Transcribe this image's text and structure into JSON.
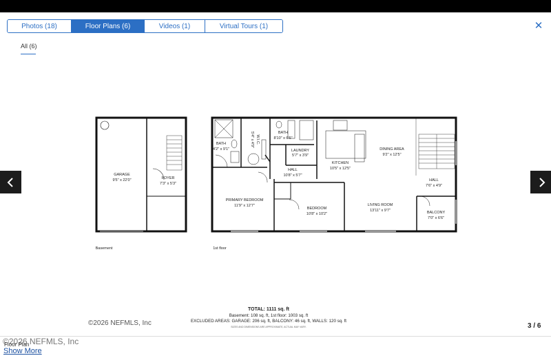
{
  "tabs": [
    {
      "label": "Photos (18)"
    },
    {
      "label": "Floor Plans (6)"
    },
    {
      "label": "Videos (1)"
    },
    {
      "label": "Virtual Tours (1)"
    }
  ],
  "active_tab": "Floor Plans (6)",
  "close_icon": "close-icon",
  "filter": {
    "label": "All (6)"
  },
  "nav": {
    "prev_icon": "chevron-left-icon",
    "next_icon": "chevron-right-icon"
  },
  "floorplan": {
    "floors": [
      {
        "label": "Basement"
      },
      {
        "label": "1st floor"
      }
    ],
    "rooms": [
      {
        "name": "GARAGE",
        "size": "9'5\" x 22'0\""
      },
      {
        "name": "FOYER",
        "size": "7'3\" x 5'3\""
      },
      {
        "name": "BATH",
        "size": "4'2\" x 9'1\""
      },
      {
        "name": "W.I.C.",
        "size": "5'4\" x 4'9\""
      },
      {
        "name": "BATH",
        "size": "8'10\" x 6'6\""
      },
      {
        "name": "LAUNDRY",
        "size": "5'7\" x 3'9\""
      },
      {
        "name": "HALL",
        "size": "10'8\" x 5'7\""
      },
      {
        "name": "KITCHEN",
        "size": "10'5\" x 12'5\""
      },
      {
        "name": "DINING AREA",
        "size": "9'2\" x 12'5\""
      },
      {
        "name": "HALL",
        "size": "7'6\" x 4'9\""
      },
      {
        "name": "PRIMARY BEDROOM",
        "size": "11'9\" x 12'7\""
      },
      {
        "name": "BEDROOM",
        "size": "10'8\" x 10'2\""
      },
      {
        "name": "LIVING ROOM",
        "size": "13'11\" x 9'7\""
      },
      {
        "name": "BALCONY",
        "size": "7'0\" x 6'6\""
      }
    ],
    "total": "TOTAL: 1111 sq. ft",
    "breakdown": "Basement: 108 sq. ft, 1st floor: 1003 sq. ft",
    "excluded": "EXCLUDED AREAS: GARAGE: 206 sq. ft, BALCONY: 46 sq. ft, WALLS: 120 sq. ft",
    "disclaimer": "SIZES AND DIMENSIONS ARE APPROXIMATE, ACTUAL MAY VARY."
  },
  "copyright_inner": "©2026 NEFMLS, Inc",
  "counter": "3 / 6",
  "copyright_outer": "©2026 NEFMLS, Inc",
  "caption": "Floor Plan",
  "show_more": "Show More"
}
